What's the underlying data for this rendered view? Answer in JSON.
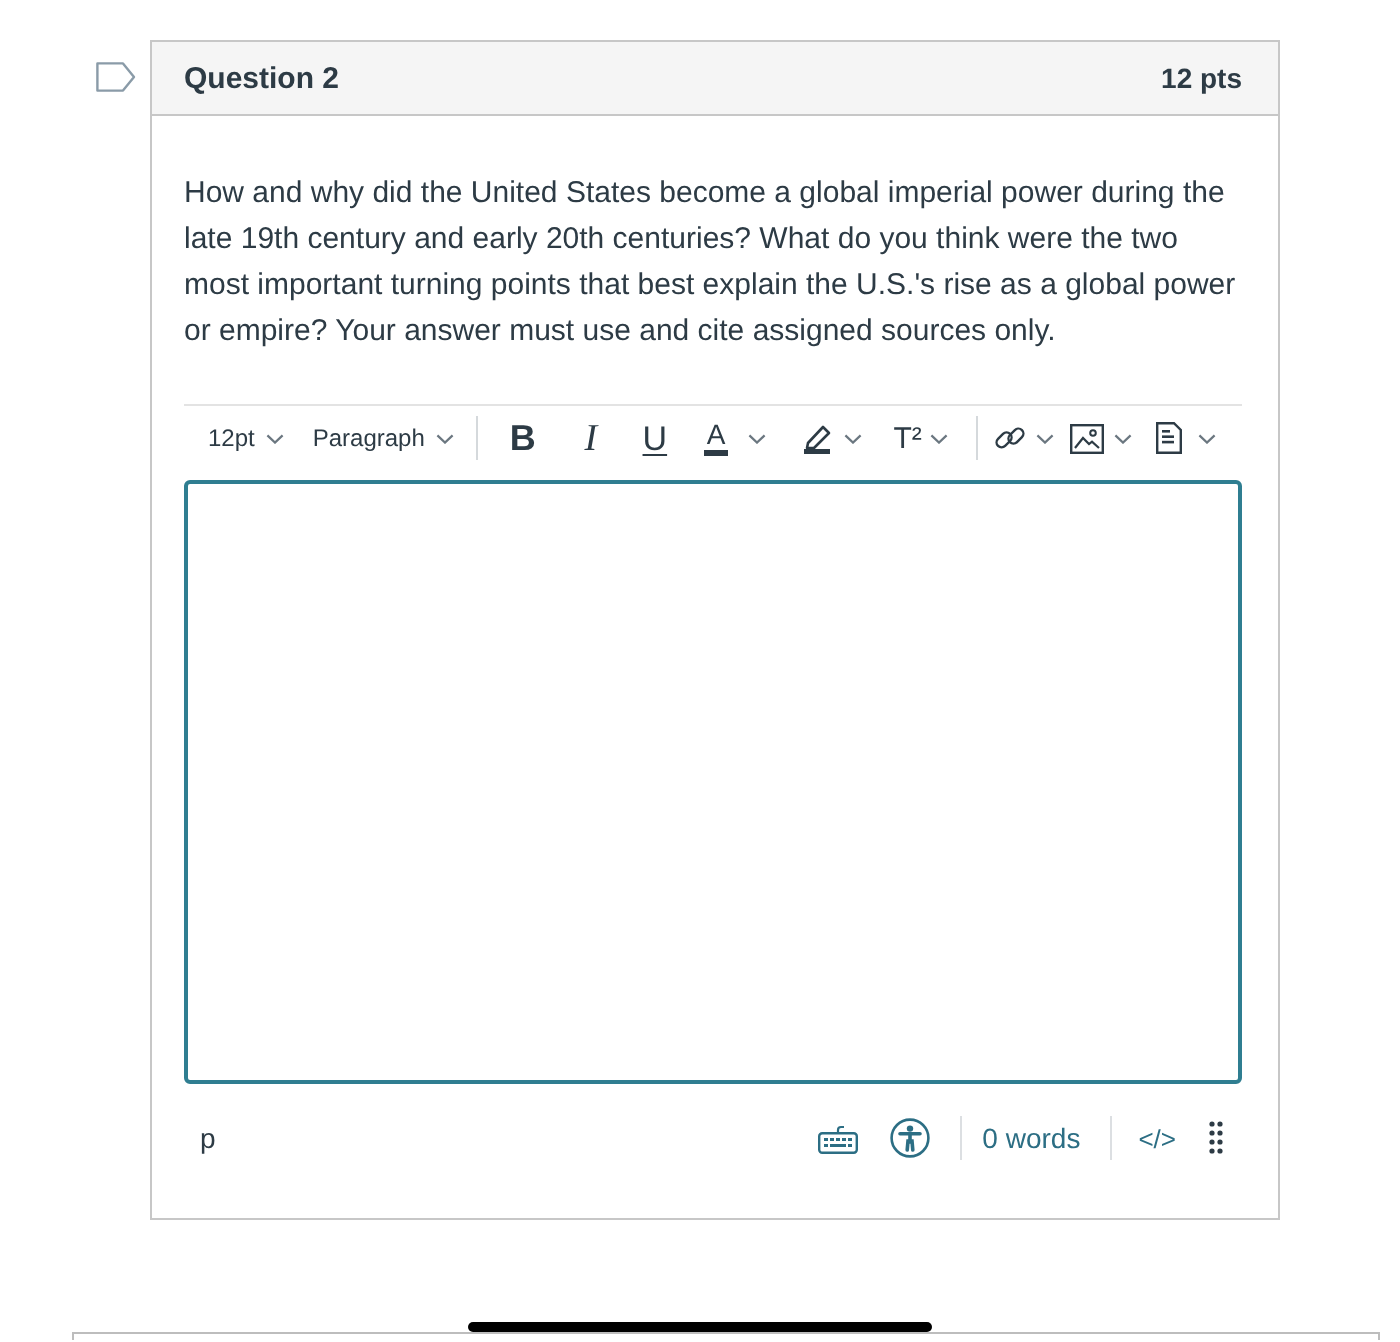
{
  "question": {
    "flagged": false,
    "title": "Question 2",
    "points": "12 pts",
    "text": "How and why did the United States become a global imperial power during the late 19th century and early 20th centuries? What do you think were the two most important turning points that best explain the U.S.'s rise as a global power or empire? Your answer must use and cite assigned sources only."
  },
  "toolbar": {
    "font_size": "12pt",
    "block_format": "Paragraph",
    "groups": [
      [
        {
          "kind": "bold",
          "label": "B",
          "menu": false
        },
        {
          "kind": "italic",
          "label": "I",
          "menu": false
        },
        {
          "kind": "underline",
          "label": "U",
          "menu": false
        },
        {
          "kind": "text-color",
          "label": "A",
          "menu": true
        },
        {
          "kind": "highlight",
          "menu": true
        },
        {
          "kind": "superscript",
          "label": "T²",
          "menu": true
        }
      ],
      [
        {
          "kind": "link",
          "menu": true
        },
        {
          "kind": "image",
          "menu": true
        },
        {
          "kind": "document",
          "menu": true
        }
      ]
    ]
  },
  "status_bar": {
    "path": "p",
    "word_count": "0 words",
    "html_toggle": "</>"
  }
}
